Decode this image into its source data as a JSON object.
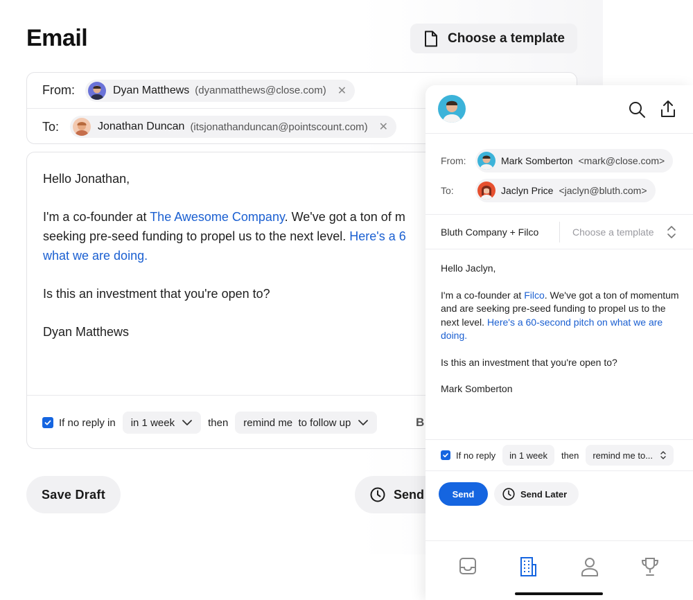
{
  "desktop": {
    "title": "Email",
    "template_button": {
      "label": "Choose a template",
      "icon": "document-icon"
    },
    "from": {
      "label": "From:",
      "name": "Dyan Matthews",
      "email": "(dyanmatthews@close.com)",
      "remove": "✕"
    },
    "to": {
      "label": "To:",
      "name": "Jonathan Duncan",
      "email": "(itsjonathanduncan@pointscount.com)",
      "remove": "✕"
    },
    "body": {
      "greeting": "Hello Jonathan,",
      "p1_start": "I'm a co-founder at ",
      "p1_link": "The Awesome Company",
      "p1_mid": ". We've got a ton of m",
      "p1_line2": "seeking pre-seed funding to propel us to the next level. ",
      "p1_link2_a": "Here's a 6",
      "p1_link2_b": "what we are doing.",
      "question": "Is this an investment that you're open to?",
      "signature": "Dyan Matthews"
    },
    "followup": {
      "checkbox_label": "If no reply in",
      "delay": "in 1 week",
      "then": "then",
      "action": "remind me  to follow up",
      "cut_text": "B"
    },
    "save_draft": "Save Draft",
    "send": "Send"
  },
  "mobile": {
    "from_label": "From:",
    "from_name": "Mark Somberton",
    "from_email": "<mark@close.com>",
    "to_label": "To:",
    "to_name": "Jaclyn Price",
    "to_email": "<jaclyn@bluth.com>",
    "company": "Bluth Company + Filco",
    "template_placeholder": "Choose a template",
    "body": {
      "greeting": "Hello Jaclyn,",
      "p1_start": "I'm a co-founder at ",
      "p1_link": "Filco",
      "p1_rest": ". We've got a ton of momentum and are seeking pre-seed funding to propel us to the next level. ",
      "p1_link2": "Here's a 60-second pitch on what we are doing.",
      "question": "Is this an investment that you're open to?",
      "signature": "Mark Somberton"
    },
    "followup": {
      "checkbox_label": "If no reply",
      "delay": "in 1 week",
      "then": "then",
      "action": "remind me to..."
    },
    "send": "Send",
    "send_later": "Send Later",
    "nav": [
      "inbox-icon",
      "company-icon",
      "contact-icon",
      "trophy-icon"
    ]
  },
  "colors": {
    "accent": "#1565e0",
    "link": "#1a5fd1",
    "chip_bg": "#f2f2f4"
  }
}
